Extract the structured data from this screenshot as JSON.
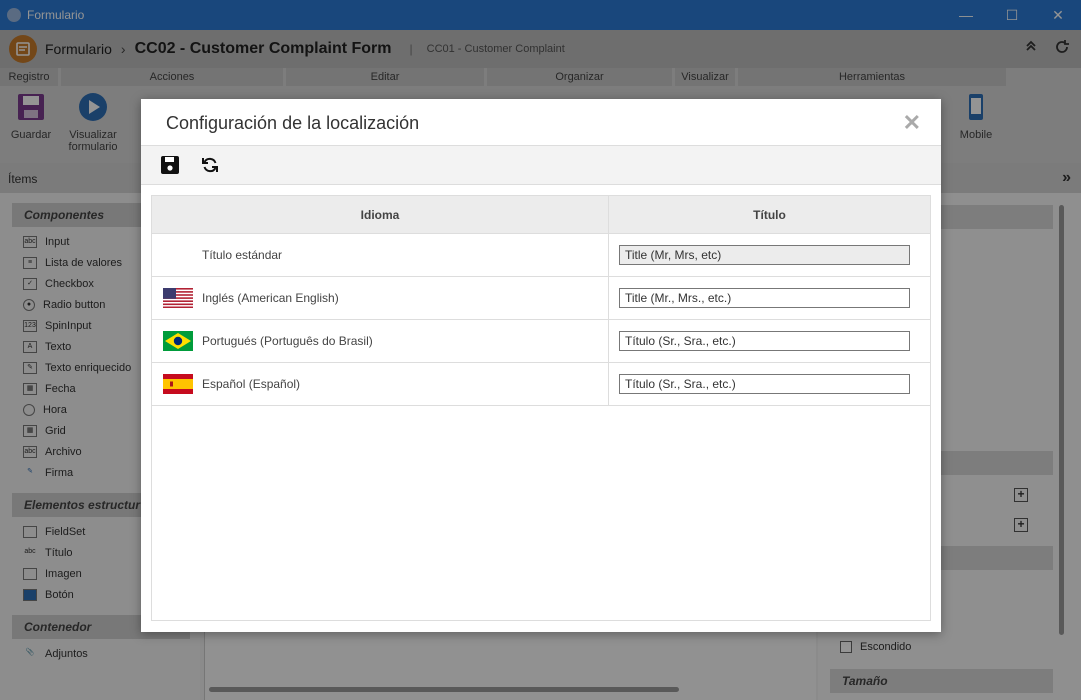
{
  "window": {
    "title": "Formulario"
  },
  "header": {
    "root": "Formulario",
    "separator": "›",
    "title": "CC02 - Customer Complaint Form",
    "divider": "|",
    "subtitle": "CC01 - Customer Complaint"
  },
  "toolbar": {
    "groups": [
      "Registro",
      "Acciones",
      "Editar",
      "Organizar",
      "Visualizar",
      "Herramientas"
    ],
    "items": {
      "save": "Guardar",
      "preview": "Visualizar formulario",
      "mobile": "Mobile"
    }
  },
  "left_panel": {
    "header": "Ítems",
    "components_title": "Componentes",
    "components": [
      "Input",
      "Lista de valores",
      "Checkbox",
      "Radio button",
      "SpinInput",
      "Texto",
      "Texto enriquecido",
      "Fecha",
      "Hora",
      "Grid",
      "Archivo",
      "Firma"
    ],
    "structural_title": "Elementos estructur",
    "structural": [
      "FieldSet",
      "Título",
      "Imagen",
      "Botón"
    ],
    "container_title": "Contenedor",
    "container": [
      "Adjuntos"
    ]
  },
  "right_panel": {
    "hidden_label": "Escondido",
    "size_title": "Tamaño"
  },
  "modal": {
    "title": "Configuración de la localización",
    "columns": {
      "language": "Idioma",
      "title": "Título"
    },
    "rows": [
      {
        "language": "Título estándar",
        "flag": "none",
        "value": "Title (Mr, Mrs, etc)",
        "readonly": true
      },
      {
        "language": "Inglés (American English)",
        "flag": "us-flag-icon",
        "value": "Title (Mr., Mrs., etc.)",
        "readonly": false
      },
      {
        "language": "Portugués (Português do Brasil)",
        "flag": "brazil-flag-icon",
        "value": "Título (Sr., Sra., etc.)",
        "readonly": false
      },
      {
        "language": "Español (Español)",
        "flag": "spain-flag-icon",
        "value": "Título (Sr., Sra., etc.)",
        "readonly": false
      }
    ]
  },
  "colors": {
    "titlebar": "#2b7bd6",
    "header": "#bdbdbd",
    "accent_orange": "#c77b2a"
  }
}
